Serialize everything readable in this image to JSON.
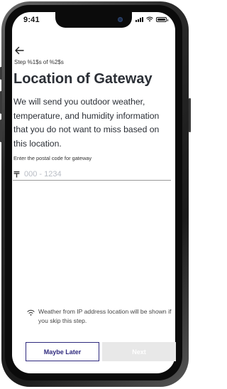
{
  "status_bar": {
    "time": "9:41"
  },
  "header": {
    "step_text": "Step %1$s of %2$s",
    "title": "Location of Gateway"
  },
  "main": {
    "description": "We will send you outdoor weather, temperature, and humidity information that you do not want to miss based on this location.",
    "postal_label": "Enter the postal code for gateway",
    "postal_symbol": "〒",
    "postal_placeholder": "000 - 1234",
    "postal_value": ""
  },
  "footer": {
    "hint_icon": "wifi-icon",
    "hint_text": "Weather from IP address location will be shown if you skip this step.",
    "later_label": "Maybe Later",
    "next_label": "Next"
  },
  "colors": {
    "primary": "#2f2a7e",
    "disabled": "#e8e8e8",
    "text": "#2b2f36"
  }
}
